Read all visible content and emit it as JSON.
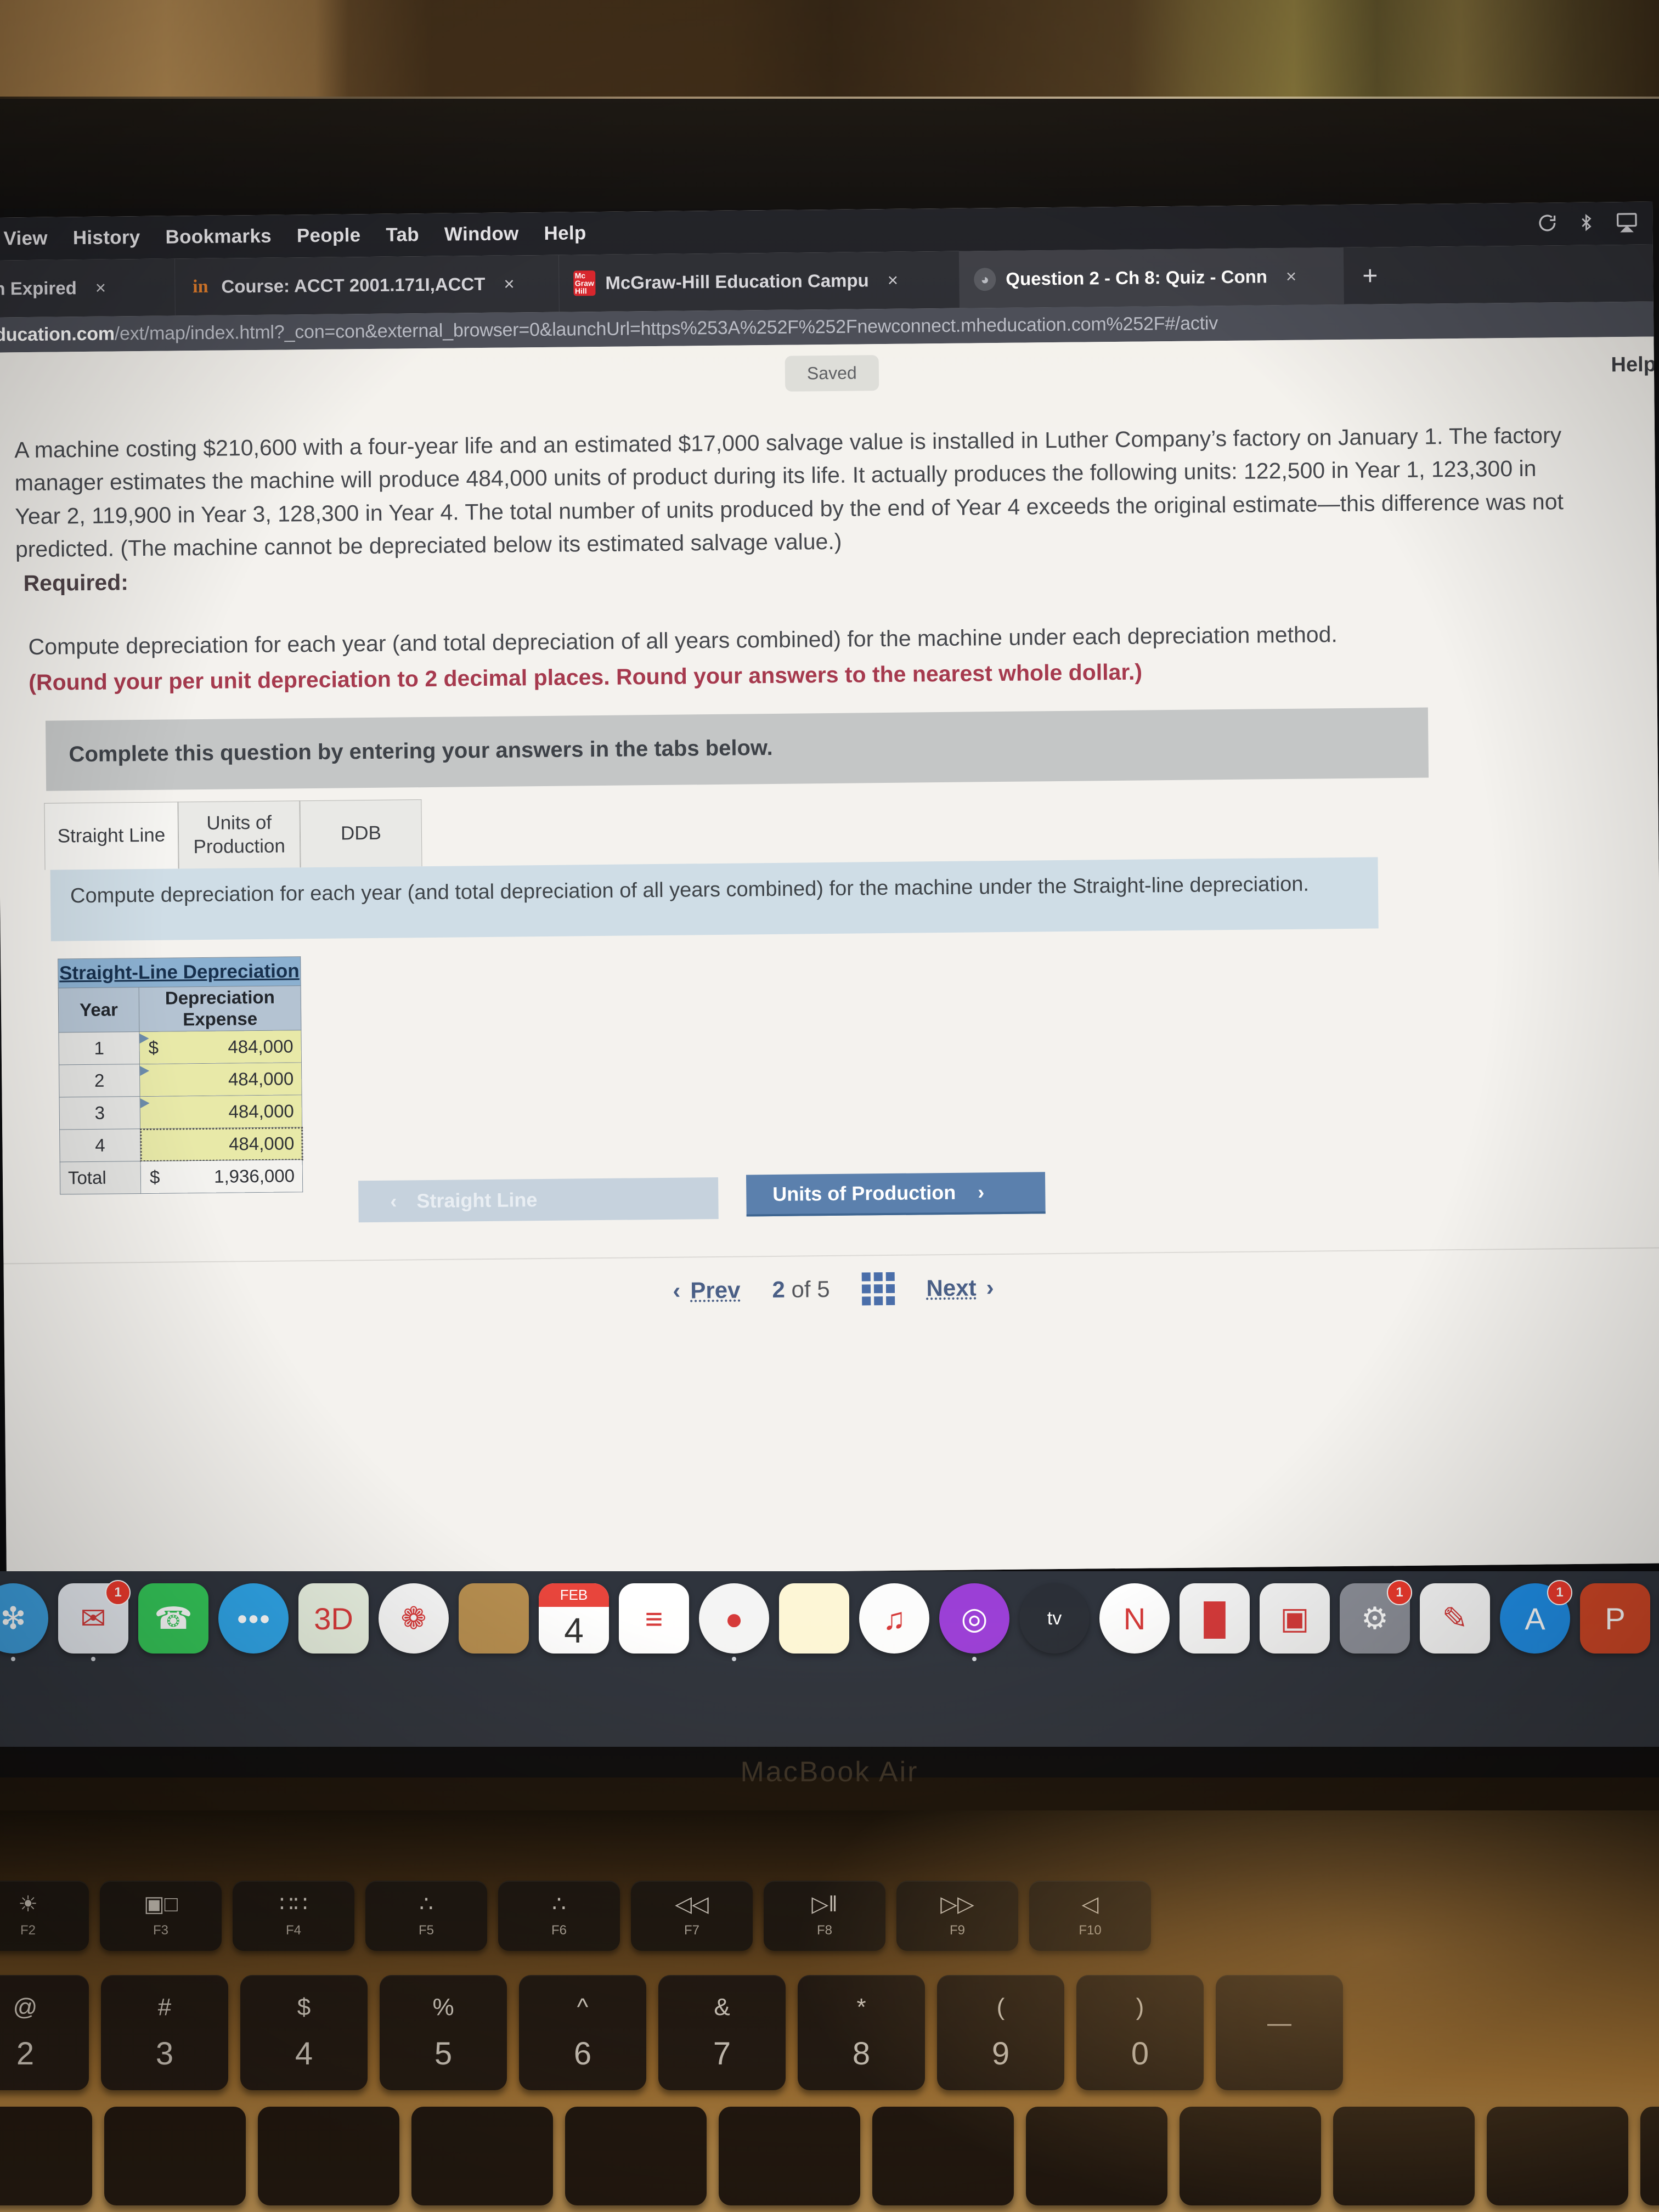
{
  "menubar": {
    "items": [
      "View",
      "History",
      "Bookmarks",
      "People",
      "Tab",
      "Window",
      "Help"
    ],
    "status_icons": [
      "refresh-icon",
      "bluetooth-icon",
      "airplay-icon",
      "wifi-icon"
    ]
  },
  "browser": {
    "tabs": [
      {
        "label": "n Expired",
        "favicon": "none",
        "active": false,
        "close": "×"
      },
      {
        "label": "Course: ACCT 2001.171I,ACCT",
        "favicon": "linkedin-learning-icon",
        "active": false,
        "close": "×"
      },
      {
        "label": "McGraw-Hill Education Campu",
        "favicon": "mcgraw-hill-icon",
        "active": false,
        "close": "×"
      },
      {
        "label": "Question 2 - Ch 8: Quiz - Conn",
        "favicon": "connect-icon",
        "active": true,
        "close": "×"
      }
    ],
    "mcgraw_favicon_text": "Mc Graw Hill",
    "new_tab_label": "+",
    "url_domain": "ducation.com",
    "url_path": "/ext/map/index.html?_con=con&external_browser=0&launchUrl=https%253A%252F%252Fnewconnect.mheducation.com%252F#/activ"
  },
  "toolbar": {
    "saved_label": "Saved",
    "help_label": "Help"
  },
  "question": {
    "body": "A machine costing $210,600 with a four-year life and an estimated $17,000 salvage value is installed in Luther Company’s factory on January 1. The factory manager estimates the machine will produce 484,000 units of product during its life. It actually produces the following units: 122,500 in Year 1, 123,300 in Year 2, 119,900 in Year 3, 128,300 in Year 4. The total number of units produced by the end of Year 4 exceeds the original estimate—this difference was not predicted. (The machine cannot be depreciated below its estimated salvage value.)",
    "required_label": "Required:",
    "required_body": "Compute depreciation for each year (and total depreciation of all years combined) for the machine under each depreciation method.",
    "required_note": "(Round your per unit depreciation to 2 decimal places. Round your answers to the nearest whole dollar.)",
    "instruction_bar": "Complete this question by entering your answers in the tabs below.",
    "method_tabs": [
      "Straight Line",
      "Units of Production",
      "DDB"
    ],
    "active_method_tab": "Straight Line",
    "blue_instruction": "Compute depreciation for each year (and total depreciation of all years combined) for the machine under the Straight-line depreciation."
  },
  "table": {
    "title": "Straight-Line Depreciation",
    "headers": [
      "Year",
      "Depreciation Expense"
    ],
    "rows": [
      {
        "year": "1",
        "currency": "$",
        "value": "484,000"
      },
      {
        "year": "2",
        "currency": "",
        "value": "484,000"
      },
      {
        "year": "3",
        "currency": "",
        "value": "484,000"
      },
      {
        "year": "4",
        "currency": "",
        "value": "484,000"
      }
    ],
    "total_label": "Total",
    "total_currency": "$",
    "total_value": "1,936,000"
  },
  "method_nav": {
    "prev_label": "Straight Line",
    "prev_chevron": "‹",
    "next_label": "Units of Production",
    "next_chevron": "›"
  },
  "pager": {
    "prev_label": "Prev",
    "prev_chevron": "‹",
    "current": "2",
    "of": "of",
    "total": "5",
    "grid_icon": "grid-9-icon",
    "next_label": "Next",
    "next_chevron": "›"
  },
  "dock": {
    "items": [
      {
        "name": "safari-icon",
        "glyph": "❇",
        "bg": "#3da0e0",
        "round": true,
        "badge": "",
        "running": true
      },
      {
        "name": "mail-icon",
        "glyph": "✉",
        "bg": "#e8ecf2",
        "round": false,
        "badge": "1",
        "running": true
      },
      {
        "name": "facetime-icon",
        "glyph": "☎",
        "bg": "#34c759",
        "round": false,
        "badge": "",
        "running": false
      },
      {
        "name": "messages-icon",
        "glyph": "●●●",
        "bg": "#2fa5e8",
        "round": true,
        "badge": "",
        "running": false
      },
      {
        "name": "maps-icon",
        "glyph": "3D",
        "bg": "#e7efdf",
        "round": false,
        "badge": "",
        "running": false
      },
      {
        "name": "photos-icon",
        "glyph": "❁",
        "bg": "#f6f6f6",
        "round": true,
        "badge": "",
        "running": false
      },
      {
        "name": "contacts-icon",
        "glyph": "",
        "bg": "#b58d4f",
        "round": false,
        "badge": "",
        "running": false
      },
      {
        "name": "calendar-icon",
        "glyph": "4",
        "bg": "#ffffff",
        "round": false,
        "badge": "",
        "running": false,
        "month": "FEB"
      },
      {
        "name": "reminders-icon",
        "glyph": "≡",
        "bg": "#ffffff",
        "round": false,
        "badge": "",
        "running": false
      },
      {
        "name": "chrome-icon",
        "glyph": "●",
        "bg": "#f4f4f4",
        "round": true,
        "badge": "",
        "running": true
      },
      {
        "name": "notes-icon",
        "glyph": "",
        "bg": "#fdf6d6",
        "round": false,
        "badge": "",
        "running": false
      },
      {
        "name": "music-icon",
        "glyph": "♫",
        "bg": "#fcfcfc",
        "round": true,
        "badge": "",
        "running": false
      },
      {
        "name": "podcasts-icon",
        "glyph": "◎",
        "bg": "#9b3fd6",
        "round": true,
        "badge": "",
        "running": true
      },
      {
        "name": "appletv-icon",
        "glyph": "\u0014tv",
        "bg": "#2b2f37",
        "round": true,
        "badge": "",
        "running": false
      },
      {
        "name": "news-icon",
        "glyph": "N",
        "bg": "#ffffff",
        "round": true,
        "badge": "",
        "running": false
      },
      {
        "name": "numbers-icon",
        "glyph": "█",
        "bg": "#f5f5f5",
        "round": false,
        "badge": "",
        "running": false
      },
      {
        "name": "keynote-icon",
        "glyph": "▣",
        "bg": "#f5f5f5",
        "round": false,
        "badge": "",
        "running": false
      },
      {
        "name": "system-preferences-icon",
        "glyph": "⚙",
        "bg": "#8d9099",
        "round": false,
        "badge": "1",
        "running": false
      },
      {
        "name": "pages-icon",
        "glyph": "✎",
        "bg": "#fbfbfb",
        "round": false,
        "badge": "",
        "running": false
      },
      {
        "name": "app-store-icon",
        "glyph": "A",
        "bg": "#1f8fe8",
        "round": true,
        "badge": "1",
        "running": false
      },
      {
        "name": "powerpoint-icon",
        "glyph": "P",
        "bg": "#d24726",
        "round": false,
        "badge": "",
        "running": false
      },
      {
        "name": "preview-icon",
        "glyph": "☷",
        "bg": "#dce6ef",
        "round": false,
        "badge": "",
        "running": true
      }
    ]
  },
  "laptop": {
    "model_label": "MacBook Air"
  },
  "keyboard": {
    "function_keys": [
      {
        "symbol": "☀",
        "label": "F2",
        "name": "brightness-up-key"
      },
      {
        "symbol": "▣□",
        "label": "F3",
        "name": "mission-control-key"
      },
      {
        "symbol": "∷∷",
        "label": "F4",
        "name": "launchpad-key"
      },
      {
        "symbol": "∴",
        "label": "F5",
        "name": "keyboard-backlight-down-key"
      },
      {
        "symbol": "∴",
        "label": "F6",
        "name": "keyboard-backlight-up-key"
      },
      {
        "symbol": "◁◁",
        "label": "F7",
        "name": "rewind-key"
      },
      {
        "symbol": "▷‖",
        "label": "F8",
        "name": "play-pause-key"
      },
      {
        "symbol": "▷▷",
        "label": "F9",
        "name": "fast-forward-key"
      },
      {
        "symbol": "◁",
        "label": "F10",
        "name": "mute-key"
      }
    ],
    "number_keys": [
      {
        "upper": "@",
        "lower": "2"
      },
      {
        "upper": "#",
        "lower": "3"
      },
      {
        "upper": "$",
        "lower": "4"
      },
      {
        "upper": "%",
        "lower": "5"
      },
      {
        "upper": "^",
        "lower": "6"
      },
      {
        "upper": "&",
        "lower": "7"
      },
      {
        "upper": "*",
        "lower": "8"
      },
      {
        "upper": "(",
        "lower": "9"
      },
      {
        "upper": ")",
        "lower": "0"
      },
      {
        "upper": "—",
        "lower": ""
      }
    ]
  },
  "colors": {
    "accent_blue": "#5b80ad",
    "table_header_blue": "#8bb0d0",
    "input_yellow": "#e8e9a8",
    "required_red": "#a63a4e",
    "link_blue": "#4a5f86"
  }
}
